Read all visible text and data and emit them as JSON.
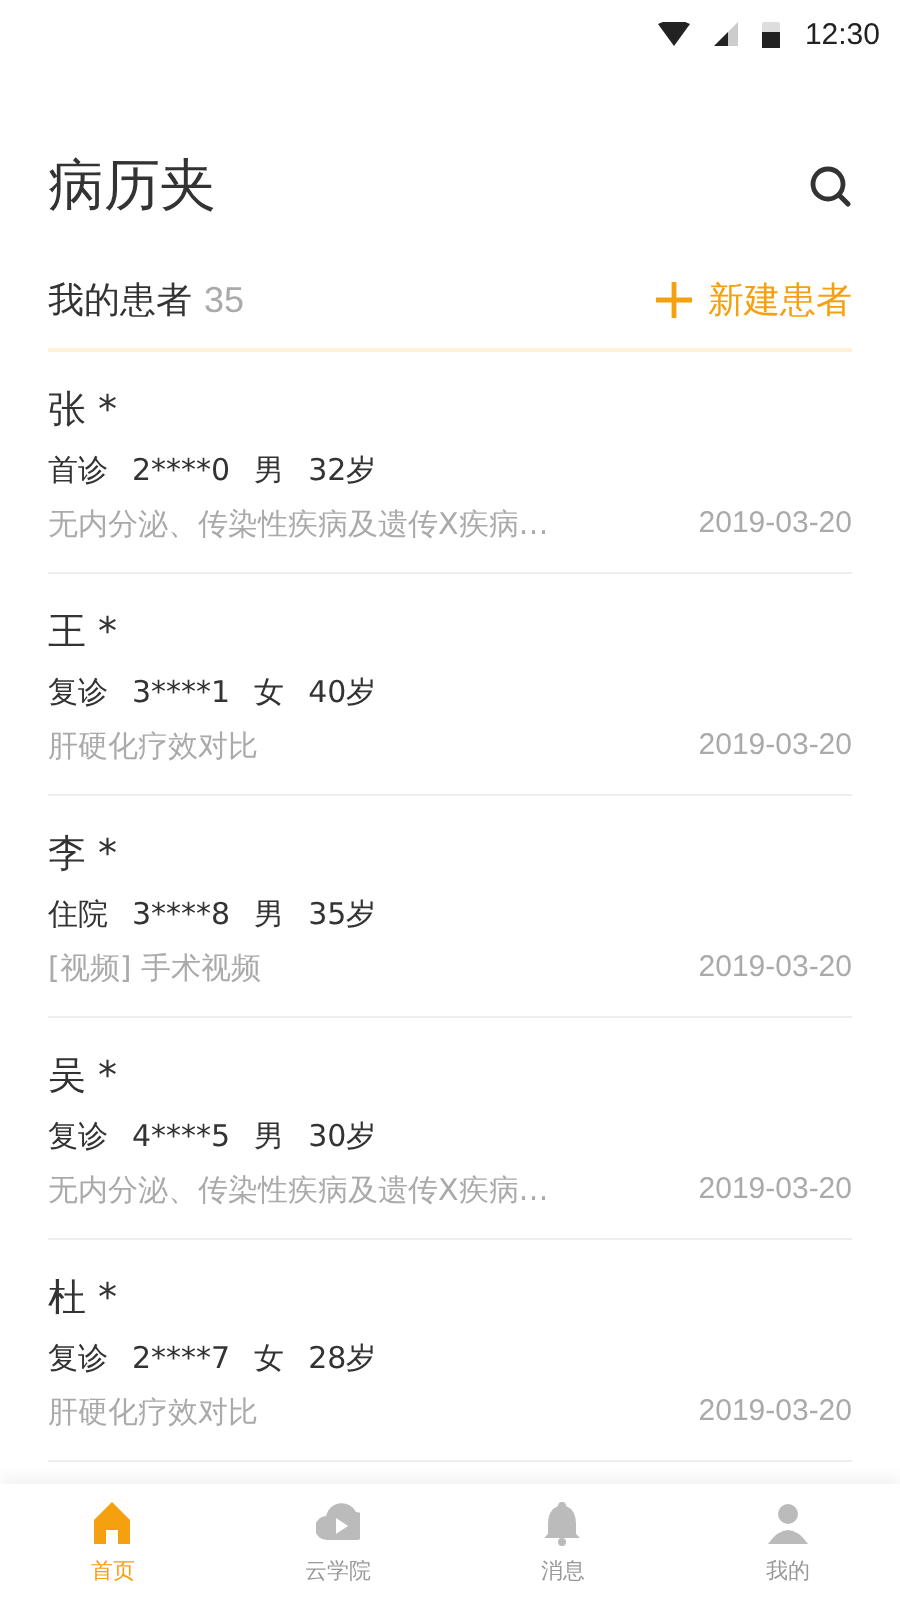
{
  "status_bar": {
    "time": "12:30"
  },
  "header": {
    "title": "病历夹"
  },
  "section": {
    "label": "我的患者",
    "count": "35",
    "action": "新建患者"
  },
  "patients": [
    {
      "name": "张 *",
      "visit_type": "首诊",
      "id": "2****0",
      "gender": "男",
      "age": "32岁",
      "note": "无内分泌、传染性疾病及遗传X疾病…",
      "date": "2019-03-20"
    },
    {
      "name": "王 *",
      "visit_type": "复诊",
      "id": "3****1",
      "gender": "女",
      "age": "40岁",
      "note": "肝硬化疗效对比",
      "date": "2019-03-20"
    },
    {
      "name": "李 *",
      "visit_type": "住院",
      "id": "3****8",
      "gender": "男",
      "age": "35岁",
      "note": "[视频] 手术视频",
      "date": "2019-03-20"
    },
    {
      "name": "吴 *",
      "visit_type": "复诊",
      "id": "4****5",
      "gender": "男",
      "age": "30岁",
      "note": "无内分泌、传染性疾病及遗传X疾病…",
      "date": "2019-03-20"
    },
    {
      "name": "杜 *",
      "visit_type": "复诊",
      "id": "2****7",
      "gender": "女",
      "age": "28岁",
      "note": "肝硬化疗效对比",
      "date": "2019-03-20"
    }
  ],
  "tab_bar": [
    {
      "kind": "home",
      "label": "首页",
      "selected": true
    },
    {
      "kind": "academy",
      "label": "云学院",
      "selected": false
    },
    {
      "kind": "messages",
      "label": "消息",
      "selected": false
    },
    {
      "kind": "profile",
      "label": "我的",
      "selected": false
    }
  ]
}
